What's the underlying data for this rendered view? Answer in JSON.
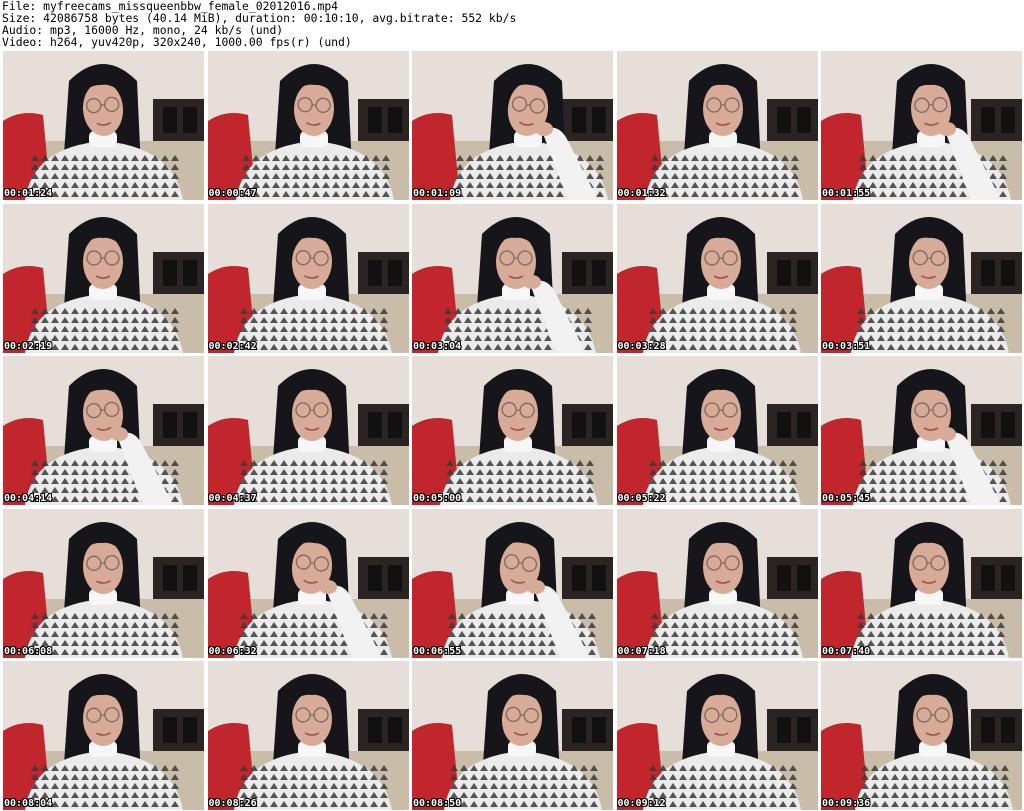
{
  "header": {
    "file_line": "File: myfreecams_missqueenbbw_female_02012016.mp4",
    "size_line": "Size: 42086758 bytes (40.14 MiB), duration: 00:10:10, avg.bitrate: 552 kb/s",
    "audio_line": "Audio: mp3, 16000 Hz, mono, 24 kb/s (und)",
    "video_line": "Video: h264, yuv420p, 320x240, 1000.00 fps(r) (und)"
  },
  "thumbnails": [
    {
      "timestamp": "00:01:24"
    },
    {
      "timestamp": "00:00:47"
    },
    {
      "timestamp": "00:01:09"
    },
    {
      "timestamp": "00:01:32"
    },
    {
      "timestamp": "00:01:55"
    },
    {
      "timestamp": "00:02:19"
    },
    {
      "timestamp": "00:02:42"
    },
    {
      "timestamp": "00:03:04"
    },
    {
      "timestamp": "00:03:28"
    },
    {
      "timestamp": "00:03:51"
    },
    {
      "timestamp": "00:04:14"
    },
    {
      "timestamp": "00:04:37"
    },
    {
      "timestamp": "00:05:00"
    },
    {
      "timestamp": "00:05:22"
    },
    {
      "timestamp": "00:05:45"
    },
    {
      "timestamp": "00:06:08"
    },
    {
      "timestamp": "00:06:32"
    },
    {
      "timestamp": "00:06:55"
    },
    {
      "timestamp": "00:07:18"
    },
    {
      "timestamp": "00:07:40"
    },
    {
      "timestamp": "00:08:04"
    },
    {
      "timestamp": "00:08:26"
    },
    {
      "timestamp": "00:08:50"
    },
    {
      "timestamp": "00:09:12"
    },
    {
      "timestamp": "00:09:36"
    }
  ],
  "colors": {
    "wall": "#e6ded8",
    "red_cloth": "#c0262b",
    "hair": "#16161a",
    "skin": "#d8aa98",
    "sweater_light": "#ebebeb",
    "sweater_dark": "#3a3a3a",
    "collar": "#f7f7f7",
    "furniture": "#2a2422"
  }
}
